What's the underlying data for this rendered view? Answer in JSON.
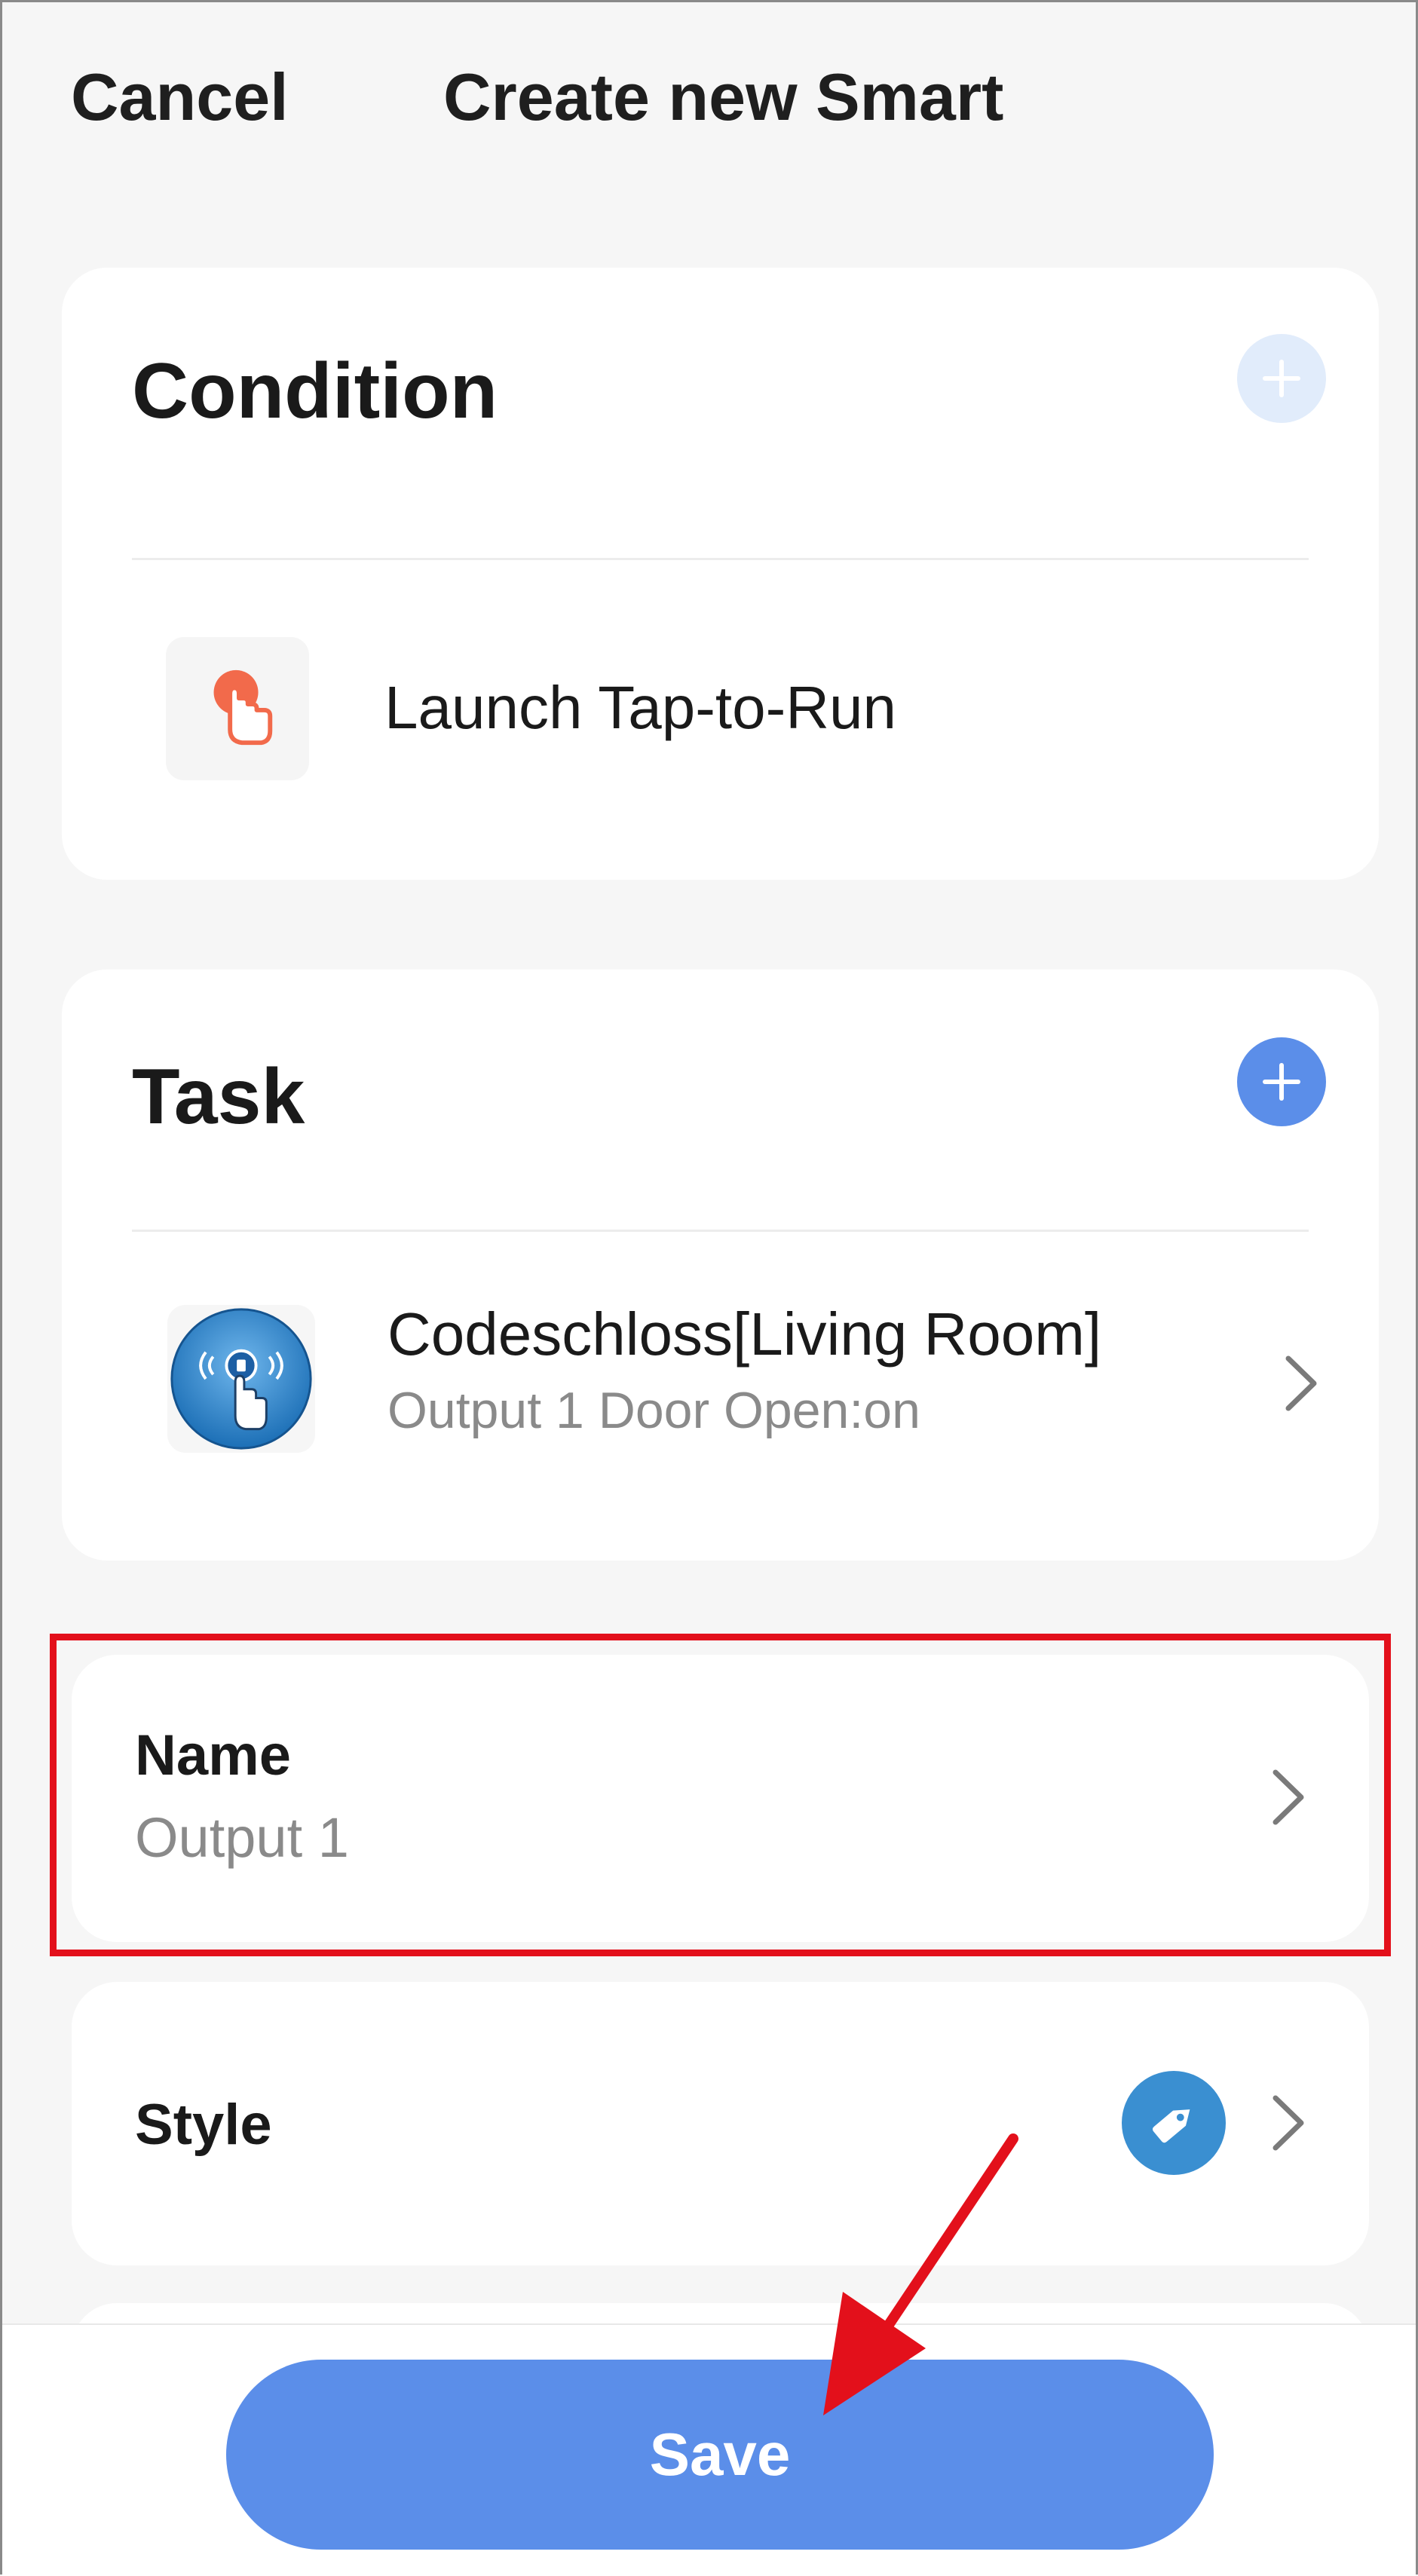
{
  "header": {
    "cancel_label": "Cancel",
    "title": "Create new Smart"
  },
  "condition": {
    "title": "Condition",
    "add_icon": "plus-icon",
    "item": {
      "icon": "tap-hand-icon",
      "label": "Launch Tap-to-Run"
    }
  },
  "task": {
    "title": "Task",
    "add_icon": "plus-icon",
    "item": {
      "icon": "door-lock-device-icon",
      "title": "Codeschloss[Living Room]",
      "subtitle": "Output 1 Door Open:on"
    }
  },
  "name_row": {
    "label": "Name",
    "value": "Output 1"
  },
  "style_row": {
    "label": "Style",
    "icon": "tag-icon"
  },
  "footer": {
    "save_label": "Save"
  },
  "colors": {
    "accent": "#5b8ee9",
    "accent_light": "#e1ecfb",
    "tap_icon": "#f26a4b",
    "highlight": "#e3101b",
    "style_tag": "#3a8fd1"
  }
}
